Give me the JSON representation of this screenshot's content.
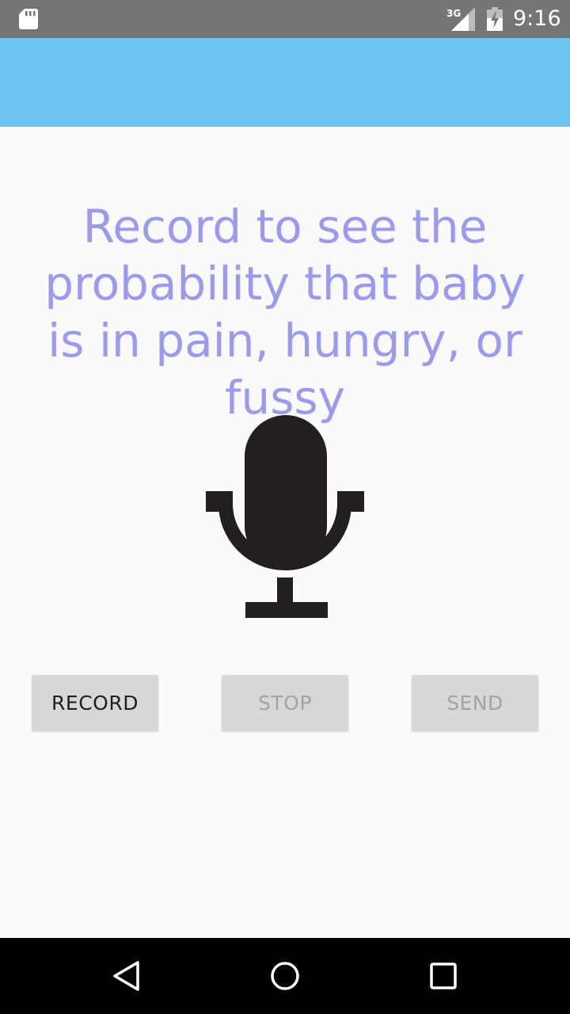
{
  "status_bar": {
    "time": "9:16",
    "network": "3G",
    "icons": [
      "sd-card-icon",
      "signal-3g-icon",
      "battery-charging-icon"
    ]
  },
  "main": {
    "prompt": "Record to see the probability that baby is in pain, hungry, or fussy",
    "mic_icon": "microphone-icon"
  },
  "buttons": {
    "record_label": "RECORD",
    "stop_label": "STOP",
    "send_label": "SEND"
  },
  "nav_bar": {
    "icons": [
      "back-icon",
      "home-icon",
      "recents-icon"
    ]
  },
  "colors": {
    "app_bar": "#6ec3f5",
    "status_bar": "#757575",
    "prompt_text": "#9a9af2",
    "button_bg": "#d6d7d7",
    "background": "#fafafa"
  }
}
